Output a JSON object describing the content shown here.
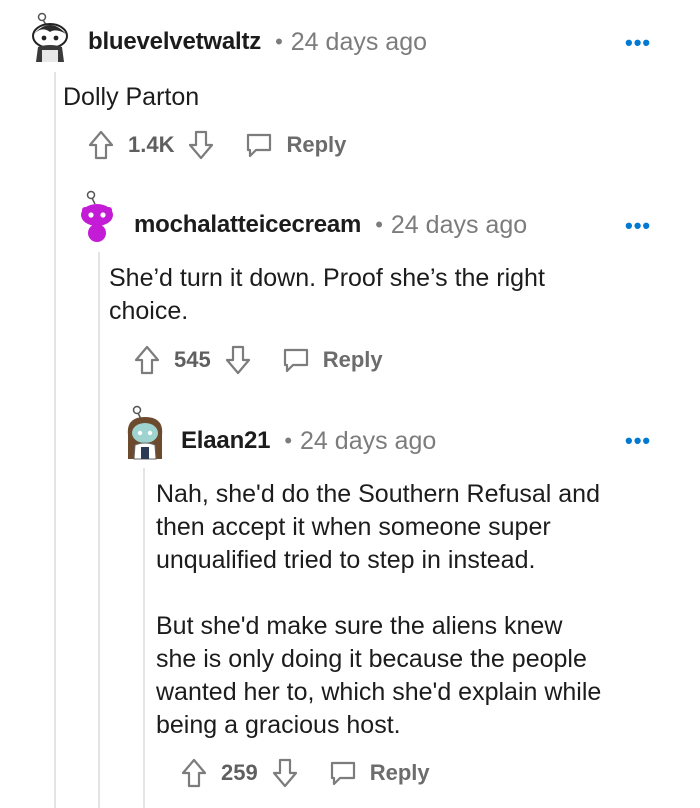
{
  "comments": [
    {
      "username": "bluevelvetwaltz",
      "separator": "•",
      "time": "24 days ago",
      "more": "•••",
      "body": "Dolly Parton",
      "score": "1.4K",
      "reply_label": "Reply",
      "avatar_icon": "snoo-avatar-dark-icon"
    },
    {
      "username": "mochalatteicecream",
      "separator": "•",
      "time": "24 days ago",
      "more": "•••",
      "body": "She’d turn it down. Proof she’s the right\nchoice.",
      "score": "545",
      "reply_label": "Reply",
      "avatar_icon": "snoo-avatar-purple-icon"
    },
    {
      "username": "Elaan21",
      "separator": "•",
      "time": "24 days ago",
      "more": "•••",
      "body": "Nah, she'd do the Southern Refusal and\nthen accept it when someone super\nunqualified tried to step in instead.\n\nBut she'd make sure the aliens knew\nshe is only doing it because the people\nwanted her to, which she'd explain while\nbeing a gracious host.",
      "score": "259",
      "reply_label": "Reply",
      "avatar_icon": "snoo-avatar-teal-icon"
    }
  ],
  "colors": {
    "link_blue": "#0079d3",
    "meta_gray": "#7c7c7c",
    "thread_line": "#e2e4e6"
  }
}
